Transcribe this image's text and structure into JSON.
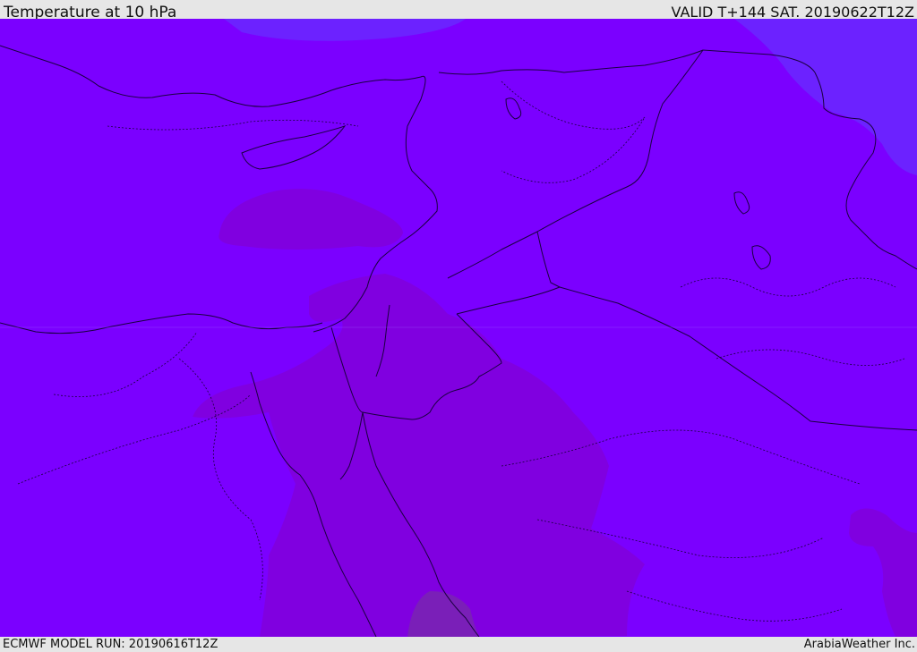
{
  "header": {
    "title": "Temperature at 10 hPa",
    "valid_time": "VALID T+144 SAT. 20190622T12Z"
  },
  "footer": {
    "model_run": "ECMWF MODEL RUN: 20190616T12Z",
    "credit": "ArabiaWeather Inc."
  },
  "map": {
    "region": "Eastern Mediterranean and Middle East",
    "colors": {
      "base_field": "#7b00ff",
      "cool_field": "#6c22ff",
      "warm_field": "#8000e0",
      "warmest_field": "#7a1fb8",
      "coastline": "#1a0040"
    }
  }
}
